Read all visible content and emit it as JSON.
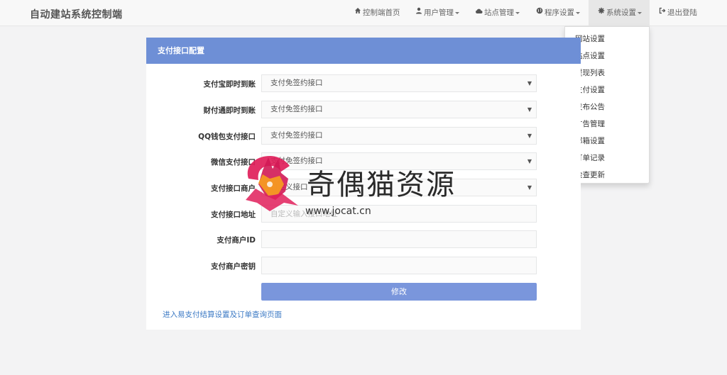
{
  "brand": "自动建站系统控制端",
  "nav": {
    "home": "控制端首页",
    "users": "用户管理",
    "sites": "站点管理",
    "programs": "程序设置",
    "system": "系统设置",
    "logout": "退出登陆"
  },
  "dropdown": {
    "items": [
      "网站设置",
      "站点设置",
      "提现列表",
      "支付设置",
      "发布公告",
      "广告管理",
      "邮箱设置",
      "订单记录",
      "检查更新"
    ]
  },
  "panel": {
    "title": "支付接口配置",
    "fields": [
      {
        "label": "支付宝即时到账",
        "value": "支付免签约接口"
      },
      {
        "label": "财付通即时到账",
        "value": "支付免签约接口"
      },
      {
        "label": "QQ钱包支付接口",
        "value": "支付免签约接口"
      },
      {
        "label": "微信支付接口",
        "value": "支付免签约接口"
      },
      {
        "label": "支付接口商户",
        "value": "自定义接口"
      },
      {
        "label": "支付接口地址",
        "value": "",
        "placeholder": "自定义输入接口地址"
      },
      {
        "label": "支付商户ID",
        "value": ""
      },
      {
        "label": "支付商户密钥",
        "value": ""
      }
    ],
    "submit": "修改",
    "link": "进入易支付结算设置及订单查询页面"
  },
  "watermark": {
    "title": "奇偶猫资源",
    "url": "www.jocat.cn"
  },
  "colors": {
    "panel_heading": "#6e8fd6",
    "button": "#7a96dc",
    "link": "#3b79c4"
  }
}
